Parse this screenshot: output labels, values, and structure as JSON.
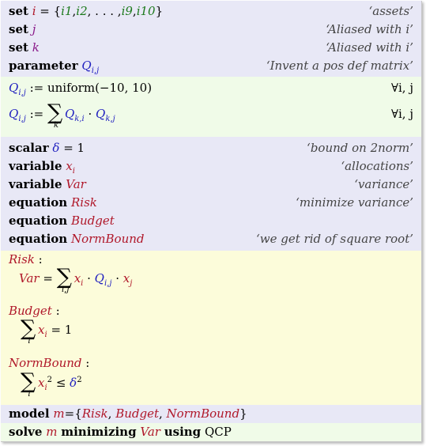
{
  "decls": {
    "set_i": {
      "keyword": "set",
      "name": "i",
      "eq": " = {",
      "members": [
        "i1",
        "i2",
        "i9",
        "i10"
      ],
      "ellipsis": ", . . . ,",
      "close": "}",
      "comment": "‘assets’"
    },
    "set_j": {
      "keyword": "set",
      "name": "j",
      "comment": "‘Aliased with i’"
    },
    "set_k": {
      "keyword": "set",
      "name": "k",
      "comment": "‘Aliased with i’"
    },
    "param_q": {
      "keyword": "parameter",
      "name": "Q",
      "index": "i,j",
      "comment": "‘Invent a pos def matrix’"
    }
  },
  "assignments": {
    "a1": {
      "lhs": "Q",
      "lhs_index": "i,j",
      "op": " := ",
      "rhs": "uniform(−10, 10)",
      "forall": "∀i, j"
    },
    "a2": {
      "lhs": "Q",
      "lhs_index": "i,j",
      "op": " := ",
      "sum_index": "k",
      "t1": "Q",
      "t1_index": "k,i",
      "dot": " · ",
      "t2": "Q",
      "t2_index": "k,j",
      "forall": "∀i, j"
    }
  },
  "vars": {
    "scalar": {
      "keyword": "scalar",
      "name": "δ",
      "value": " = 1",
      "comment": "‘bound on 2norm’"
    },
    "variable_x": {
      "keyword": "variable",
      "name": "x",
      "index": "i",
      "comment": "‘allocations’"
    },
    "variable_var": {
      "keyword": "variable",
      "name": "Var",
      "comment": "‘variance’"
    },
    "eq_risk": {
      "keyword": "equation",
      "name": "Risk",
      "comment": "‘minimize variance’"
    },
    "eq_budget": {
      "keyword": "equation",
      "name": "Budget",
      "comment": ""
    },
    "eq_norm": {
      "keyword": "equation",
      "name": "NormBound",
      "comment": "‘we get rid of square root’"
    }
  },
  "equations": {
    "risk": {
      "name": "Risk",
      "colon": " :",
      "lhs": "Var",
      "eq": " = ",
      "sum_index": "i,j",
      "x": "x",
      "x_index": "i",
      "dot": " · ",
      "q": "Q",
      "q_index": "i,j",
      "dot2": " · ",
      "x2": "x",
      "x2_index": "j"
    },
    "budget": {
      "name": "Budget",
      "colon": " :",
      "sum_index": "i",
      "x": "x",
      "x_index": "i",
      "rhs": " = 1"
    },
    "norm": {
      "name": "NormBound",
      "colon": " :",
      "sum_index": "i",
      "x": "x",
      "x_index": "i",
      "x_pow": "2",
      "le": " ≤ ",
      "delta": "δ",
      "delta_pow": "2"
    }
  },
  "model": {
    "keyword": "model",
    "name": "m",
    "eq": "={",
    "members": [
      "Risk",
      "Budget",
      "NormBound"
    ],
    "sep": ", ",
    "close": "}",
    "solve_kw": "solve",
    "solve_name": "m",
    "minimizing": "minimizing",
    "obj": "Var",
    "using": "using",
    "type": "QCP"
  },
  "symbols": {
    "sigma": "∑"
  }
}
